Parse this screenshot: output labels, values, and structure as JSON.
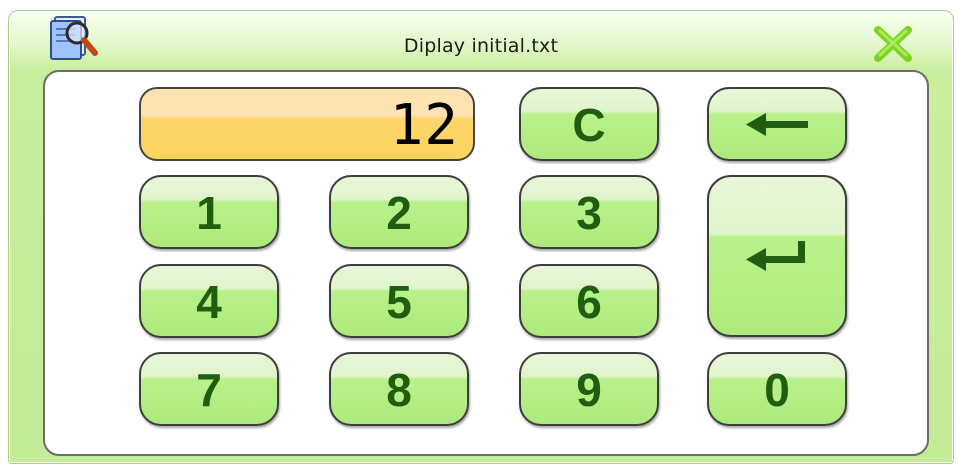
{
  "window": {
    "title": "Diplay initial.txt",
    "icons": {
      "app": "notepad-magnifier-icon",
      "close": "close-x-icon"
    }
  },
  "display": {
    "value": "12"
  },
  "keypad": {
    "clear": "C",
    "backspace_icon": "backspace-arrow-icon",
    "enter_icon": "enter-return-icon",
    "digits": {
      "d1": "1",
      "d2": "2",
      "d3": "3",
      "d4": "4",
      "d5": "5",
      "d6": "6",
      "d7": "7",
      "d8": "8",
      "d9": "9",
      "d0": "0"
    }
  },
  "colors": {
    "key_label": "#1f5d10",
    "display_fill": "#fbd35f",
    "window_green": "#c5ec98",
    "close_x": "#7ed321"
  }
}
